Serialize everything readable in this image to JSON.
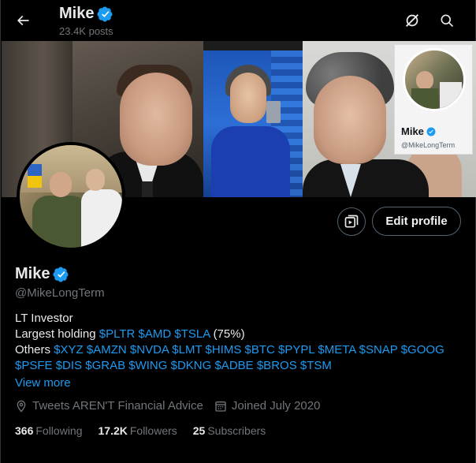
{
  "header": {
    "back_icon": "arrow-left-icon",
    "title": "Mike",
    "posts_count": "23.4K posts",
    "right_icons": [
      "grok-slash-icon",
      "search-icon"
    ]
  },
  "banner": {
    "mini_card": {
      "name": "Mike",
      "handle": "@MikeLongTerm"
    }
  },
  "profile": {
    "name": "Mike",
    "verified": true,
    "handle": "@MikeLongTerm",
    "edit_label": "Edit profile",
    "bio": {
      "line1": "LT Investor",
      "line2_prefix": "Largest holding ",
      "line2_tags": [
        "$PLTR",
        "$AMD",
        "$TSLA"
      ],
      "line2_suffix": "(75%)",
      "line3_prefix": "Others ",
      "line3_tags": [
        "$XYZ",
        "$AMZN",
        "$NVDA",
        "$LMT",
        "$HIMS",
        "$BTC",
        "$PYPL",
        "$META",
        "$SNAP",
        "$GOOG"
      ],
      "line4_tags": [
        "$PSFE",
        "$DIS",
        "$GRAB",
        "$WING",
        "$DKNG",
        "$ADBE",
        "$BROS",
        "$TSM"
      ]
    },
    "view_more": "View more",
    "location": "Tweets AREN'T Financial Advice",
    "joined": "Joined July 2020",
    "stats": {
      "following_count": "366",
      "following_label": "Following",
      "followers_count": "17.2K",
      "followers_label": "Followers",
      "subscribers_count": "25",
      "subscribers_label": "Subscribers"
    }
  },
  "colors": {
    "accent": "#1d9bf0",
    "background": "#000000",
    "text_primary": "#e7e9ea",
    "text_secondary": "#71767b"
  }
}
